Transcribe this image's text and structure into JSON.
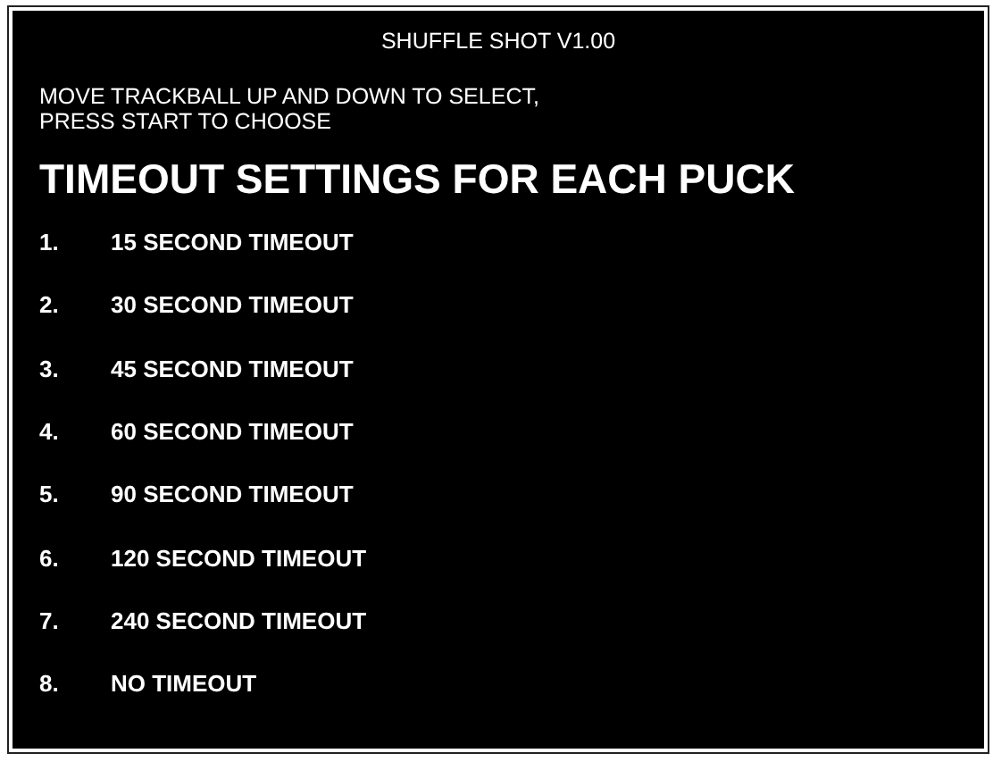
{
  "title": "SHUFFLE SHOT V1.00",
  "instructions": [
    "MOVE TRACKBALL UP AND DOWN TO SELECT,",
    "PRESS START TO CHOOSE"
  ],
  "heading": "TIMEOUT SETTINGS FOR EACH PUCK",
  "options": [
    {
      "number": "1.",
      "label": "15 SECOND TIMEOUT"
    },
    {
      "number": "2.",
      "label": "30 SECOND TIMEOUT"
    },
    {
      "number": "3.",
      "label": "45 SECOND TIMEOUT"
    },
    {
      "number": "4.",
      "label": "60 SECOND TIMEOUT"
    },
    {
      "number": "5.",
      "label": "90 SECOND TIMEOUT"
    },
    {
      "number": "6.",
      "label": "120 SECOND TIMEOUT"
    },
    {
      "number": "7.",
      "label": "240 SECOND TIMEOUT"
    },
    {
      "number": "8.",
      "label": "NO TIMEOUT"
    }
  ]
}
